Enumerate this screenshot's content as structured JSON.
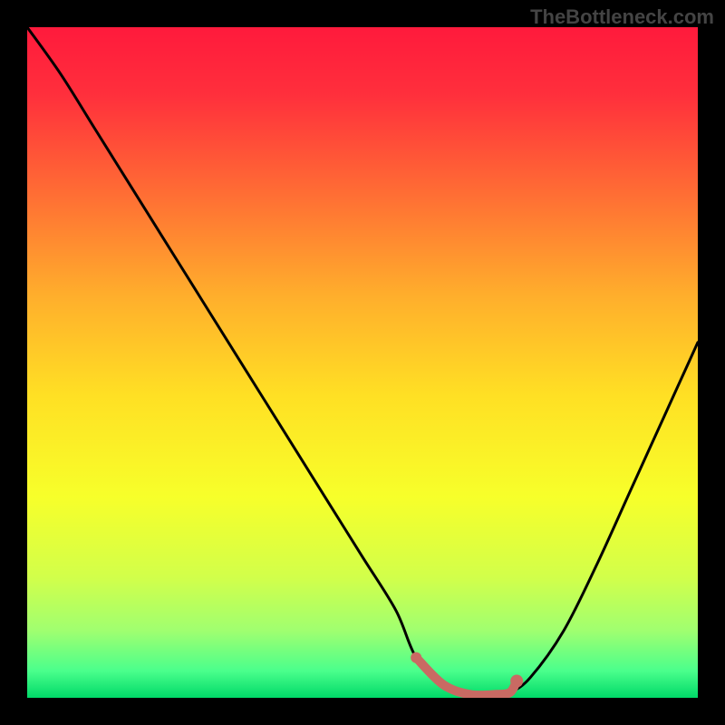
{
  "watermark": "TheBottleneck.com",
  "chart_data": {
    "type": "line",
    "title": "",
    "xlabel": "",
    "ylabel": "",
    "xlim": [
      0,
      100
    ],
    "ylim": [
      0,
      100
    ],
    "series": [
      {
        "name": "bottleneck-curve",
        "x": [
          0,
          5,
          10,
          15,
          20,
          25,
          30,
          35,
          40,
          45,
          50,
          55,
          58,
          62,
          66,
          70,
          72,
          75,
          80,
          85,
          90,
          95,
          100
        ],
        "y": [
          100,
          93,
          85,
          77,
          69,
          61,
          53,
          45,
          37,
          29,
          21,
          13,
          6,
          2,
          0.5,
          0.5,
          0.8,
          3,
          10,
          20,
          31,
          42,
          53
        ]
      },
      {
        "name": "optimum-segment",
        "x": [
          58,
          62,
          66,
          70,
          72,
          73
        ],
        "y": [
          6,
          2,
          0.5,
          0.5,
          0.8,
          2.5
        ]
      }
    ],
    "annotations": [],
    "background_gradient": {
      "stops": [
        {
          "offset": 0.0,
          "color": "#ff1a3c"
        },
        {
          "offset": 0.1,
          "color": "#ff2f3c"
        },
        {
          "offset": 0.25,
          "color": "#ff6e34"
        },
        {
          "offset": 0.4,
          "color": "#ffae2c"
        },
        {
          "offset": 0.55,
          "color": "#ffe024"
        },
        {
          "offset": 0.7,
          "color": "#f7ff2a"
        },
        {
          "offset": 0.82,
          "color": "#d2ff4a"
        },
        {
          "offset": 0.9,
          "color": "#a0ff70"
        },
        {
          "offset": 0.96,
          "color": "#4aff8c"
        },
        {
          "offset": 1.0,
          "color": "#00d968"
        }
      ]
    },
    "curve_color": "#000000",
    "optimum_color": "#c96a63"
  }
}
